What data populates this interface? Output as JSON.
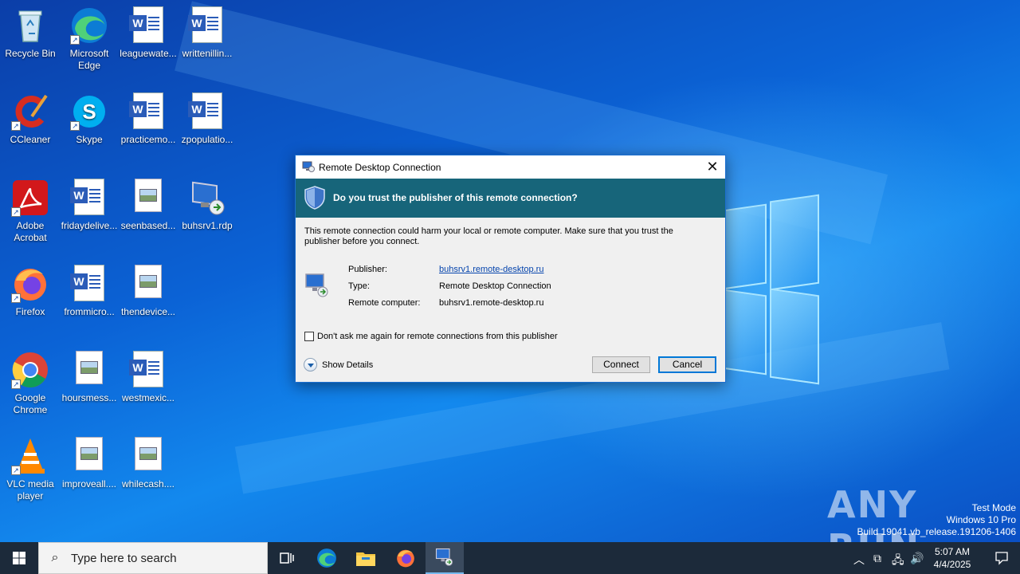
{
  "desktop": {
    "icons": [
      {
        "label": "Recycle Bin",
        "icon": "recycle-bin-icon"
      },
      {
        "label": "Microsoft Edge",
        "icon": "edge-icon"
      },
      {
        "label": "leaguewate...",
        "icon": "word-doc-icon"
      },
      {
        "label": "writtenillin...",
        "icon": "word-doc-icon"
      },
      {
        "label": "CCleaner",
        "icon": "ccleaner-icon"
      },
      {
        "label": "Skype",
        "icon": "skype-icon"
      },
      {
        "label": "practicemo...",
        "icon": "word-doc-icon"
      },
      {
        "label": "zpopulatio...",
        "icon": "word-doc-icon"
      },
      {
        "label": "Adobe Acrobat",
        "icon": "acrobat-icon"
      },
      {
        "label": "fridaydelive...",
        "icon": "word-doc-icon"
      },
      {
        "label": "seenbased...",
        "icon": "image-file-icon"
      },
      {
        "label": "buhsrv1.rdp",
        "icon": "rdp-file-icon"
      },
      {
        "label": "Firefox",
        "icon": "firefox-icon"
      },
      {
        "label": "frommicro...",
        "icon": "word-doc-icon"
      },
      {
        "label": "thendevice...",
        "icon": "image-file-icon"
      },
      {
        "label": "Google Chrome",
        "icon": "chrome-icon"
      },
      {
        "label": "hoursmess...",
        "icon": "image-file-icon"
      },
      {
        "label": "westmexic...",
        "icon": "word-doc-icon"
      },
      {
        "label": "VLC media player",
        "icon": "vlc-icon"
      },
      {
        "label": "improveall....",
        "icon": "image-file-icon"
      },
      {
        "label": "whilecash....",
        "icon": "image-file-icon"
      }
    ]
  },
  "dialog": {
    "title": "Remote Desktop Connection",
    "close_label": "✕",
    "banner": "Do you trust the publisher of this remote connection?",
    "warning": "This remote connection could harm your local or remote computer. Make sure that you trust the publisher before you connect.",
    "publisher_label": "Publisher:",
    "publisher_value": "buhsrv1.remote-desktop.ru",
    "type_label": "Type:",
    "type_value": "Remote Desktop Connection",
    "remote_label": "Remote computer:",
    "remote_value": "buhsrv1.remote-desktop.ru",
    "checkbox_label": "Don't ask me again for remote connections from this publisher",
    "checkbox_checked": false,
    "details_label": "Show Details",
    "connect_label": "Connect",
    "cancel_label": "Cancel"
  },
  "watermark": {
    "brand": "ANY RUN",
    "line1": "Test Mode",
    "line2": "Windows 10 Pro",
    "line3": "Build 19041.vb_release.191206-1406"
  },
  "taskbar": {
    "search_placeholder": "Type here to search",
    "apps": [
      "task-view-icon",
      "edge-icon",
      "file-explorer-icon",
      "firefox-icon",
      "remote-desktop-icon"
    ],
    "time": "5:07 AM",
    "date": "4/4/2025"
  },
  "colors": {
    "banner": "#17657a",
    "taskbar": "#1c2a3a",
    "link": "#0645ad"
  }
}
